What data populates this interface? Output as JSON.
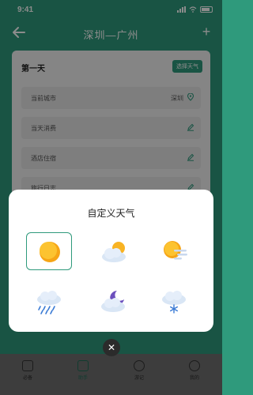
{
  "status": {
    "time": "9:41"
  },
  "nav": {
    "title": "深圳—广州"
  },
  "card": {
    "day_title": "第一天",
    "weather_button": "选择天气",
    "rows": [
      {
        "label": "当前城市",
        "value": "深圳",
        "icon": "location-icon"
      },
      {
        "label": "当天消费",
        "value": "",
        "icon": "edit-icon"
      },
      {
        "label": "酒店住宿",
        "value": "",
        "icon": "edit-icon"
      },
      {
        "label": "旅行日志",
        "value": "",
        "icon": "edit-icon"
      }
    ]
  },
  "dialog": {
    "title": "自定义天气",
    "options": [
      {
        "icon": "sunny-icon",
        "selected": true
      },
      {
        "icon": "partly-cloudy-icon",
        "selected": false
      },
      {
        "icon": "hazy-sun-icon",
        "selected": false
      },
      {
        "icon": "rain-icon",
        "selected": false
      },
      {
        "icon": "cloudy-night-icon",
        "selected": false
      },
      {
        "icon": "snow-icon",
        "selected": false
      }
    ]
  },
  "tabbar": {
    "tabs": [
      {
        "label": "必备",
        "icon": "briefcase-icon",
        "active": false
      },
      {
        "label": "助手",
        "icon": "assistant-icon",
        "active": true
      },
      {
        "label": "游记",
        "icon": "send-icon",
        "active": false
      },
      {
        "label": "我的",
        "icon": "profile-icon",
        "active": false
      }
    ]
  },
  "colors": {
    "accent": "#2f9a7c",
    "overlay": "#000000"
  }
}
